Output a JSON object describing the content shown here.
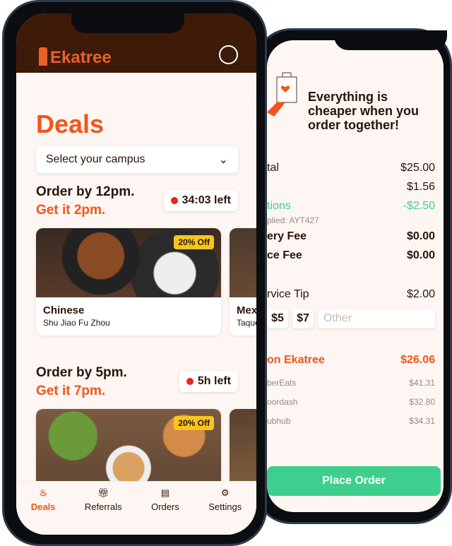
{
  "colors": {
    "brand": "#f4541c",
    "header": "#3e1a09",
    "discount": "#3ecf8e",
    "cta": "#3ecf8e"
  },
  "checkout": {
    "headline": "Everything is cheaper when you order together!",
    "subtotal": {
      "label": "tal",
      "value": "$25.00"
    },
    "tax": {
      "value": "$1.56"
    },
    "promotions": {
      "label": "tions",
      "value": "-$2.50",
      "applied": "plied: AYT427"
    },
    "delivery_fee": {
      "label": "ery Fee",
      "value": "$0.00"
    },
    "service_fee": {
      "label": "ce Fee",
      "value": "$0.00"
    },
    "service_tip": {
      "label": "rvice Tip",
      "value": "$2.00",
      "options": [
        "$5",
        "$7"
      ],
      "other_placeholder": "Other"
    },
    "total": {
      "label": "on Ekatree",
      "value": "$26.06"
    },
    "comparisons": [
      {
        "label": "berEats",
        "value": "$41.31"
      },
      {
        "label": "oordash",
        "value": "$32.80"
      },
      {
        "label": "ubhub",
        "value": "$34.31"
      }
    ],
    "place_order": "Place Order"
  },
  "app": {
    "logo": "Ekatree",
    "page_title": "Deals",
    "campus_select": "Select your campus",
    "slots": [
      {
        "order_by": "Order by 12pm.",
        "get_it": "Get it 2pm.",
        "timer": "34:03 left",
        "cards": [
          {
            "cuisine": "Chinese",
            "restaurant": "Shu Jiao Fu Zhou",
            "badge": "20% Off"
          },
          {
            "cuisine": "Mex",
            "restaurant": "Taque"
          }
        ]
      },
      {
        "order_by": "Order by 5pm.",
        "get_it": "Get it 7pm.",
        "timer": "5h left",
        "cards": [
          {
            "badge": "20% Off"
          }
        ]
      }
    ],
    "nav": [
      {
        "label": "Deals",
        "icon": "flame-icon",
        "active": true
      },
      {
        "label": "Referrals",
        "icon": "gift-icon"
      },
      {
        "label": "Orders",
        "icon": "receipt-icon"
      },
      {
        "label": "Settings",
        "icon": "gear-icon"
      }
    ]
  }
}
